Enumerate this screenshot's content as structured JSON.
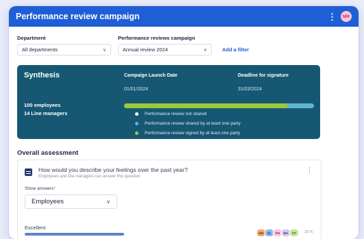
{
  "header": {
    "title": "Performance review campaign",
    "menu_glyph": "⋮",
    "avatar_initials": "MR"
  },
  "filters": {
    "department": {
      "label": "Department",
      "value": "All departments"
    },
    "campaign": {
      "label": "Performance reviews campaign",
      "value": "Annual review 2024"
    },
    "add_filter": "Add a filter"
  },
  "synthesis": {
    "title": "Synthesis",
    "launch_label": "Campaign Launch Date",
    "launch_value": "01/01/2024",
    "deadline_label": "Deadline for signature",
    "deadline_value": "31/03/2024",
    "employees": "100 employees",
    "managers": "14 Line managers",
    "progress": {
      "signed": 0.86,
      "shared": 0.0,
      "not_shared": 0.14
    },
    "colors": {
      "signed": "#9cc83a",
      "shared": "#5fb6d3",
      "not_shared": "#ffffff"
    },
    "legend": [
      {
        "label": "Performance review not shared",
        "color": "#ffffff"
      },
      {
        "label": "Performance review shared by at least one party",
        "color": "#5fb6d3"
      },
      {
        "label": "Performance review signed by at least one party",
        "color": "#9cc83a"
      }
    ]
  },
  "assessment": {
    "title": "Overall assessment",
    "question": "How would you describe your feelings over the past year?",
    "subtitle": "Employees and line managers can answer this question",
    "show_answers_label": "Show answers",
    "required_mark": "*",
    "answers_value": "Employees",
    "option_label": "Excellent",
    "option_percent": "20 %",
    "respondents": [
      {
        "initials": "MR",
        "bg": "#f3a86b",
        "fg": "#7a3a10"
      },
      {
        "initials": "SL",
        "bg": "#8fb6ee",
        "fg": "#1c3d7a"
      },
      {
        "initials": "PH",
        "bg": "#f7c7d6",
        "fg": "#a42457"
      },
      {
        "initials": "MA",
        "bg": "#d4c6f0",
        "fg": "#4b2f8a"
      },
      {
        "initials": "CF",
        "bg": "#bfe6a0",
        "fg": "#2f6a12"
      }
    ]
  }
}
